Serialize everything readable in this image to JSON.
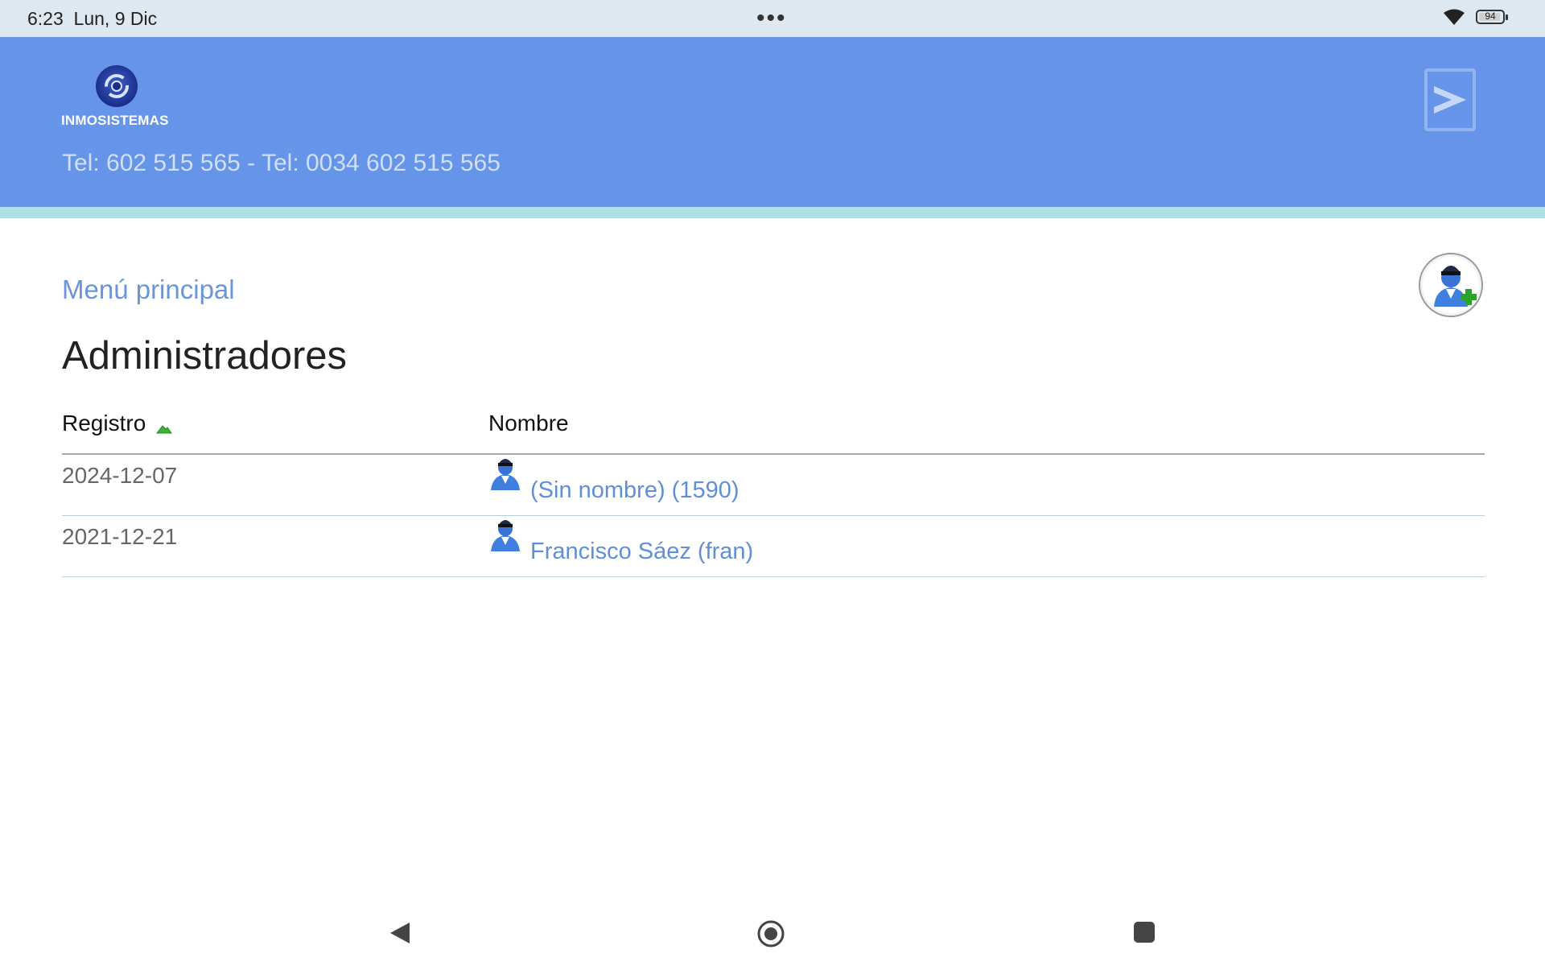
{
  "status_bar": {
    "time": "6:23",
    "date": "Lun, 9 Dic",
    "dots": "•••",
    "battery_level": "94"
  },
  "header": {
    "logo_text": "INMOSISTEMAS",
    "phones": "Tel: 602 515 565 - Tel: 0034 602 515 565",
    "exit_icon": "exit-arrow-icon"
  },
  "main": {
    "menu_link": "Menú principal",
    "title": "Administradores",
    "add_icon": "add-user-icon"
  },
  "table": {
    "columns": [
      "Registro",
      "Nombre"
    ],
    "sort": {
      "column": "Registro",
      "direction": "ascending-icon"
    },
    "rows": [
      {
        "date": "2024-12-07",
        "name": "(Sin nombre) (1590)"
      },
      {
        "date": "2021-12-21",
        "name": "Francisco Sáez (fran)"
      }
    ]
  },
  "nav": {
    "back": "back-icon",
    "home": "home-icon",
    "recent": "recent-apps-icon"
  },
  "colors": {
    "header_bg": "#6694e8",
    "stripe": "#afe0e6",
    "link": "#6a95d8"
  }
}
